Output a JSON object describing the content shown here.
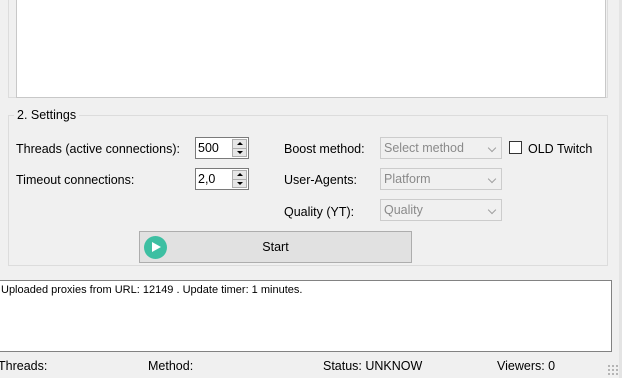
{
  "settings": {
    "legend": "2. Settings",
    "threads_label": "Threads (active connections):",
    "threads_value": "500",
    "timeout_label": "Timeout connections:",
    "timeout_value": "2,0",
    "boost_label": "Boost method:",
    "boost_placeholder": "Select method",
    "useragents_label": "User-Agents:",
    "useragents_value": "Platform",
    "quality_label": "Quality (YT):",
    "quality_value": "Quality",
    "old_twitch_label": "OLD Twitch",
    "old_twitch_checked": false,
    "start_label": "Start"
  },
  "log": {
    "lines": [
      "Uploaded proxies from URL: 12149 . Update timer: 1 minutes."
    ]
  },
  "status": {
    "threads": "Threads:",
    "method": "Method:",
    "status": "Status: UNKNOW",
    "viewers": "Viewers: 0"
  },
  "icons": {
    "start": "play-circle-icon",
    "accent_color": "#3dbfa2"
  }
}
